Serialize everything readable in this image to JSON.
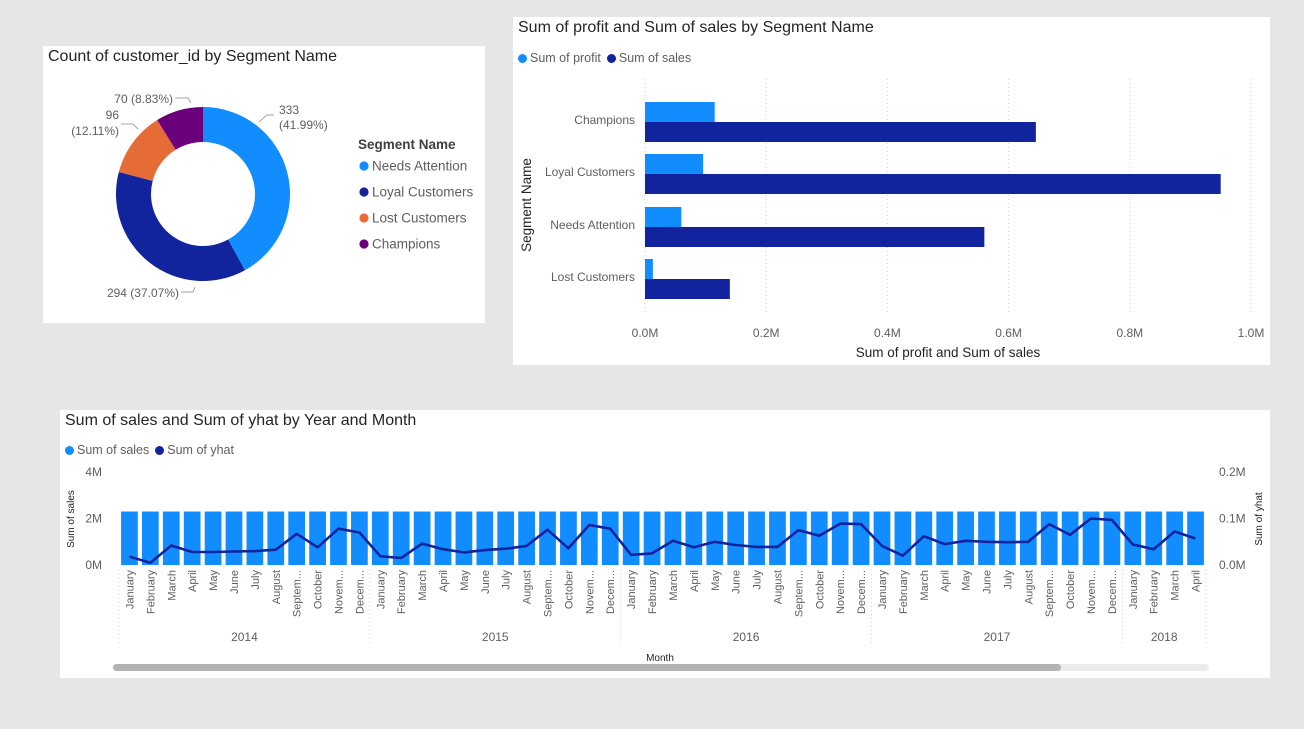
{
  "colors": {
    "light_blue": "#118dff",
    "dark_blue": "#12239e",
    "orange": "#e66c37",
    "purple": "#6b007b",
    "text": "#252423",
    "subtle": "#605e5c"
  },
  "donut": {
    "title": "Count of customer_id by Segment Name",
    "legend_title": "Segment Name",
    "legend": [
      "Needs Attention",
      "Loyal Customers",
      "Lost Customers",
      "Champions"
    ],
    "labels": {
      "needs_attention": [
        "333",
        "(41.99%)"
      ],
      "loyal": "294 (37.07%)",
      "lost": [
        "96",
        "(12.11%)"
      ],
      "champions": "70 (8.83%)"
    }
  },
  "bar": {
    "title": "Sum of profit and Sum of sales by Segment Name",
    "legend": [
      "Sum of profit",
      "Sum of sales"
    ],
    "ylabel": "Segment Name",
    "xlabel": "Sum of profit and Sum of sales",
    "ticks": [
      "0.0M",
      "0.2M",
      "0.4M",
      "0.6M",
      "0.8M",
      "1.0M"
    ]
  },
  "combo": {
    "title": "Sum of sales and Sum of yhat by Year and Month",
    "legend": [
      "Sum of sales",
      "Sum of yhat"
    ],
    "ylabel_left": "Sum of sales",
    "ylabel_right": "Sum of yhat",
    "xlabel": "Month",
    "left_ticks": [
      "4M",
      "2M",
      "0M"
    ],
    "right_ticks": [
      "0.2M",
      "0.1M",
      "0.0M"
    ]
  },
  "chart_data": [
    {
      "type": "pie",
      "title": "Count of customer_id by Segment Name",
      "legend_title": "Segment Name",
      "categories": [
        "Needs Attention",
        "Loyal Customers",
        "Lost Customers",
        "Champions"
      ],
      "values": [
        333,
        294,
        96,
        70
      ],
      "percents": [
        41.99,
        37.07,
        12.11,
        8.83
      ],
      "colors": [
        "#118dff",
        "#12239e",
        "#e66c37",
        "#6b007b"
      ],
      "donut": true,
      "legend_position": "right"
    },
    {
      "type": "bar",
      "orientation": "horizontal",
      "title": "Sum of profit and Sum of sales by Segment Name",
      "categories": [
        "Champions",
        "Loyal Customers",
        "Needs Attention",
        "Lost Customers"
      ],
      "series": [
        {
          "name": "Sum of profit",
          "values": [
            115000,
            96000,
            60000,
            13000
          ],
          "color": "#118dff"
        },
        {
          "name": "Sum of sales",
          "values": [
            645000,
            950000,
            560000,
            140000
          ],
          "color": "#12239e"
        }
      ],
      "xlabel": "Sum of profit and Sum of sales",
      "ylabel": "Segment Name",
      "xlim": [
        0,
        1000000
      ],
      "grid": true,
      "legend_position": "top-left"
    },
    {
      "type": "bar",
      "title": "Sum of sales and Sum of yhat by Year and Month",
      "years": [
        {
          "label": "2014",
          "months": [
            "January",
            "February",
            "March",
            "April",
            "May",
            "June",
            "July",
            "August",
            "Septem...",
            "October",
            "Novem...",
            "Decem..."
          ]
        },
        {
          "label": "2015",
          "months": [
            "January",
            "February",
            "March",
            "April",
            "May",
            "June",
            "July",
            "August",
            "Septem...",
            "October",
            "Novem...",
            "Decem..."
          ]
        },
        {
          "label": "2016",
          "months": [
            "January",
            "February",
            "March",
            "April",
            "May",
            "June",
            "July",
            "August",
            "Septem...",
            "October",
            "Novem...",
            "Decem..."
          ]
        },
        {
          "label": "2017",
          "months": [
            "January",
            "February",
            "March",
            "April",
            "May",
            "June",
            "July",
            "August",
            "Septem...",
            "October",
            "Novem...",
            "Decem..."
          ]
        },
        {
          "label": "2018",
          "months": [
            "January",
            "February",
            "March",
            "April"
          ]
        }
      ],
      "series": [
        {
          "name": "Sum of sales",
          "type": "bar",
          "axis": "left",
          "color": "#118dff",
          "values": [
            2300000,
            2300000,
            2300000,
            2300000,
            2300000,
            2300000,
            2300000,
            2300000,
            2300000,
            2300000,
            2300000,
            2300000,
            2300000,
            2300000,
            2300000,
            2300000,
            2300000,
            2300000,
            2300000,
            2300000,
            2300000,
            2300000,
            2300000,
            2300000,
            2300000,
            2300000,
            2300000,
            2300000,
            2300000,
            2300000,
            2300000,
            2300000,
            2300000,
            2300000,
            2300000,
            2300000,
            2300000,
            2300000,
            2300000,
            2300000,
            2300000,
            2300000,
            2300000,
            2300000,
            2300000,
            2300000,
            2300000,
            2300000,
            2300000,
            2300000,
            2300000,
            2300000
          ]
        },
        {
          "name": "Sum of yhat",
          "type": "line",
          "axis": "right",
          "color": "#12239e",
          "values": [
            18000,
            5000,
            42000,
            28000,
            28000,
            29000,
            30000,
            33000,
            67000,
            38000,
            78000,
            70000,
            19000,
            15000,
            46000,
            34000,
            27000,
            32000,
            35000,
            41000,
            76000,
            36000,
            86000,
            78000,
            22000,
            25000,
            52000,
            38000,
            50000,
            43000,
            39000,
            39000,
            75000,
            63000,
            89000,
            88000,
            41000,
            20000,
            62000,
            45000,
            52000,
            50000,
            49000,
            50000,
            88000,
            65000,
            100000,
            97000,
            44000,
            34000,
            72000,
            57000
          ]
        }
      ],
      "ylabel": "Sum of sales",
      "ylabel_right": "Sum of yhat",
      "xlabel": "Month",
      "ylim": [
        0,
        4000000
      ],
      "ylim_right": [
        0,
        200000
      ],
      "legend_position": "top-left"
    }
  ]
}
